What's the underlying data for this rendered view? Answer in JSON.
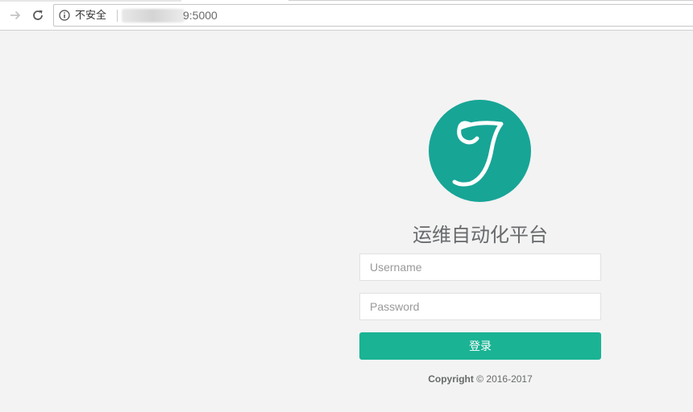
{
  "browser": {
    "security_label": "不安全",
    "url_visible": "9:5000",
    "icons": {
      "forward": "arrow-right-icon",
      "reload": "reload-icon",
      "info": "info-icon"
    }
  },
  "login": {
    "title": "运维自动化平台",
    "username_placeholder": "Username",
    "password_placeholder": "Password",
    "submit_label": "登录",
    "copyright_bold": "Copyright",
    "copyright_rest": "© 2016-2017"
  },
  "colors": {
    "page_bg": "#f3f3f3",
    "logo_bg": "#17a596",
    "button_bg": "#1ab394",
    "title_text": "#676a6c"
  }
}
